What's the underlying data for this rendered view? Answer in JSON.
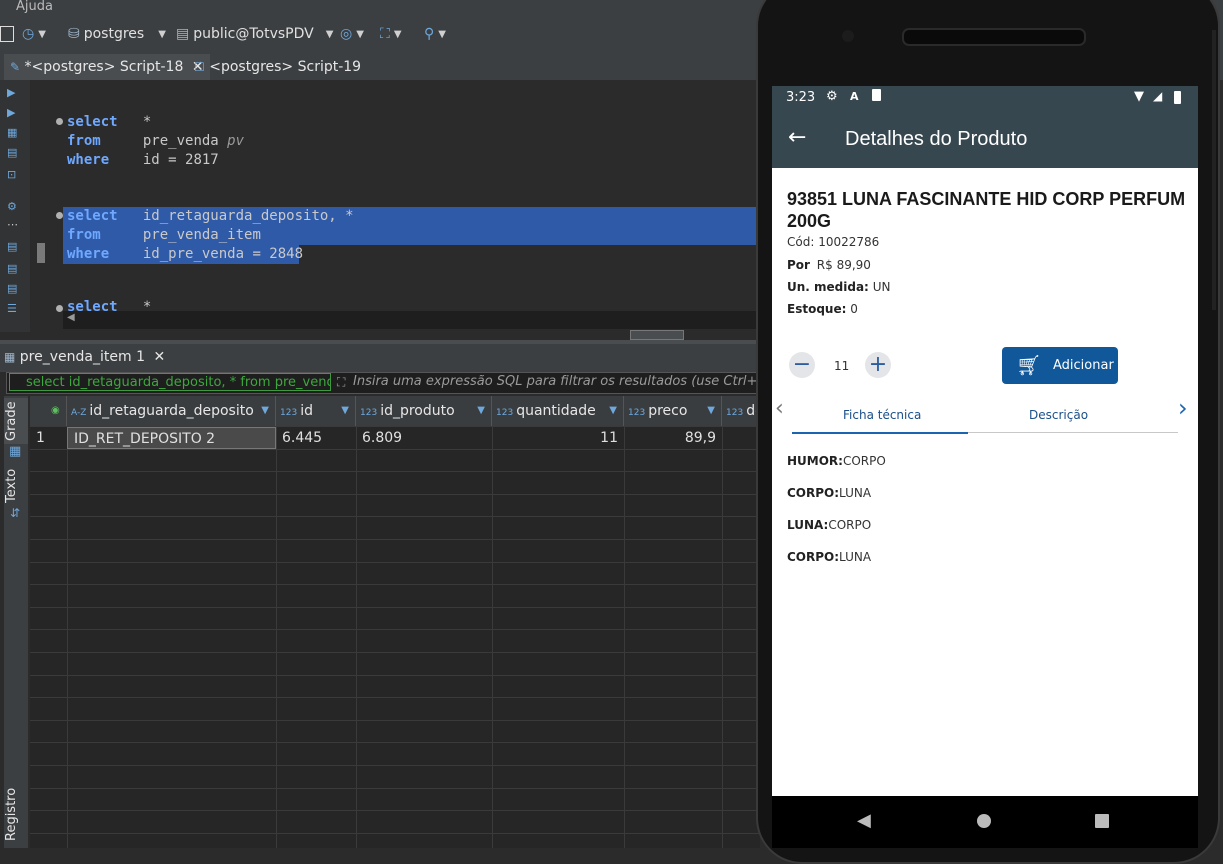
{
  "menu": {
    "ajuda": "Ajuda"
  },
  "toolbar": {
    "db": "postgres",
    "schema": "public@TotvsPDV"
  },
  "editor_tabs": [
    {
      "label": "*<postgres> Script-18"
    },
    {
      "label": "<postgres> Script-19"
    }
  ],
  "editor": {
    "q1": {
      "select": "select",
      "cols": "*",
      "from": "from",
      "table": "pre_venda",
      "alias": "pv",
      "where": "where",
      "cond": "id = 2817"
    },
    "q2": {
      "select": "select",
      "cols": "id_retaguarda_deposito, *",
      "from": "from",
      "table": "pre_venda_item",
      "where": "where",
      "cond": "id_pre_venda = 2848"
    },
    "q3": {
      "select": "select",
      "cols": "*"
    }
  },
  "results": {
    "tab_label": "pre_venda_item 1",
    "filter_value": "select id_retaguarda_deposito, * from pre_venda",
    "filter_hint": "Insira uma expressão SQL para filtrar os resultados (use Ctrl+Espaço)",
    "side_tabs": {
      "grade": "Grade",
      "texto": "Texto",
      "registro": "Registro"
    },
    "columns": [
      {
        "type": "A-Z",
        "name": "id_retaguarda_deposito"
      },
      {
        "type": "123",
        "name": "id"
      },
      {
        "type": "123",
        "name": "id_produto"
      },
      {
        "type": "123",
        "name": "quantidade"
      },
      {
        "type": "123",
        "name": "preco"
      },
      {
        "type": "123",
        "name": "de"
      }
    ],
    "rows": [
      {
        "num": "1",
        "id_retaguarda_deposito": "ID_RET_DEPOSITO 2",
        "id": "6.445",
        "id_produto": "6.809",
        "quantidade": "11",
        "preco": "89,9"
      }
    ]
  },
  "phone": {
    "time": "3:23",
    "title": "Detalhes do Produto",
    "product_title": "93851  LUNA FASCINANTE HID CORP PERFUM 200G",
    "cod": "Cód: 10022786",
    "por_label": "Por",
    "por_value": "R$ 89,90",
    "medida_label": "Un. medida:",
    "medida_value": "UN",
    "estoque_label": "Estoque:",
    "estoque_value": "0",
    "quantity": "11",
    "add_label": "Adicionar",
    "tabs": {
      "ficha": "Ficha técnica",
      "descricao": "Descrição"
    },
    "specs": [
      {
        "key": "HUMOR:",
        "value": "CORPO"
      },
      {
        "key": "CORPO:",
        "value": "LUNA"
      },
      {
        "key": "LUNA:",
        "value": "CORPO"
      },
      {
        "key": "CORPO:",
        "value": "LUNA"
      }
    ]
  }
}
